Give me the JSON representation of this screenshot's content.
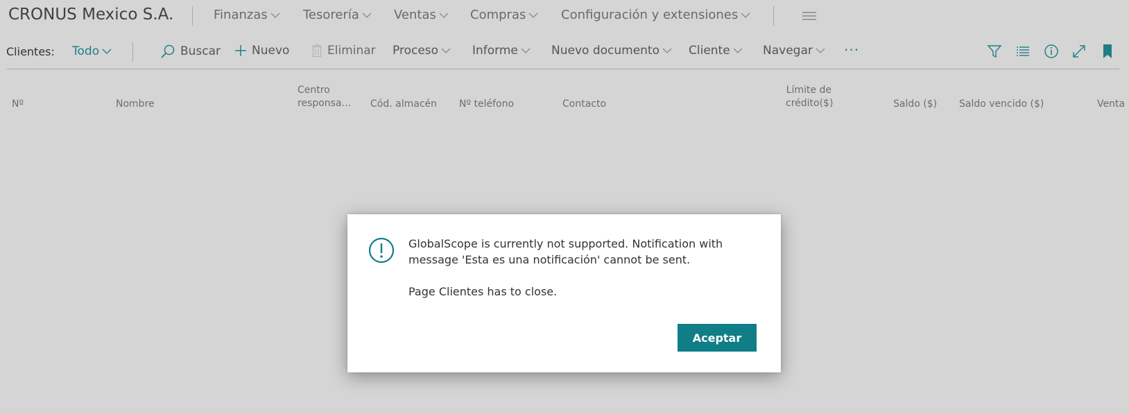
{
  "appbar": {
    "company": "CRONUS Mexico S.A.",
    "nav": [
      {
        "label": "Finanzas"
      },
      {
        "label": "Tesorería"
      },
      {
        "label": "Ventas"
      },
      {
        "label": "Compras"
      },
      {
        "label": "Configuración y extensiones"
      }
    ]
  },
  "actionbar": {
    "page_label": "Clientes:",
    "view_label": "Todo",
    "search_label": "Buscar",
    "new_label": "Nuevo",
    "delete_label": "Eliminar",
    "menus": [
      {
        "label": "Proceso"
      },
      {
        "label": "Informe"
      },
      {
        "label": "Nuevo documento"
      },
      {
        "label": "Cliente"
      },
      {
        "label": "Navegar"
      }
    ],
    "more_label": "···"
  },
  "columns": {
    "no": "Nº",
    "name": "Nombre",
    "center_1": "Centro",
    "center_2": "responsa...",
    "warehouse": "Cód. almacén",
    "phone": "Nº teléfono",
    "contact": "Contacto",
    "credit_1": "Límite de",
    "credit_2": "crédito($)",
    "balance": "Saldo ($)",
    "overdue": "Saldo vencido ($)",
    "sales": "Venta"
  },
  "dialog": {
    "message": "GlobalScope is currently not supported. Notification with message 'Esta es una notificación' cannot be sent.",
    "message2": "Page Clientes has to close.",
    "ok_label": "Aceptar"
  },
  "colors": {
    "accent": "#0f7e86",
    "background": "#d5d5d5"
  }
}
